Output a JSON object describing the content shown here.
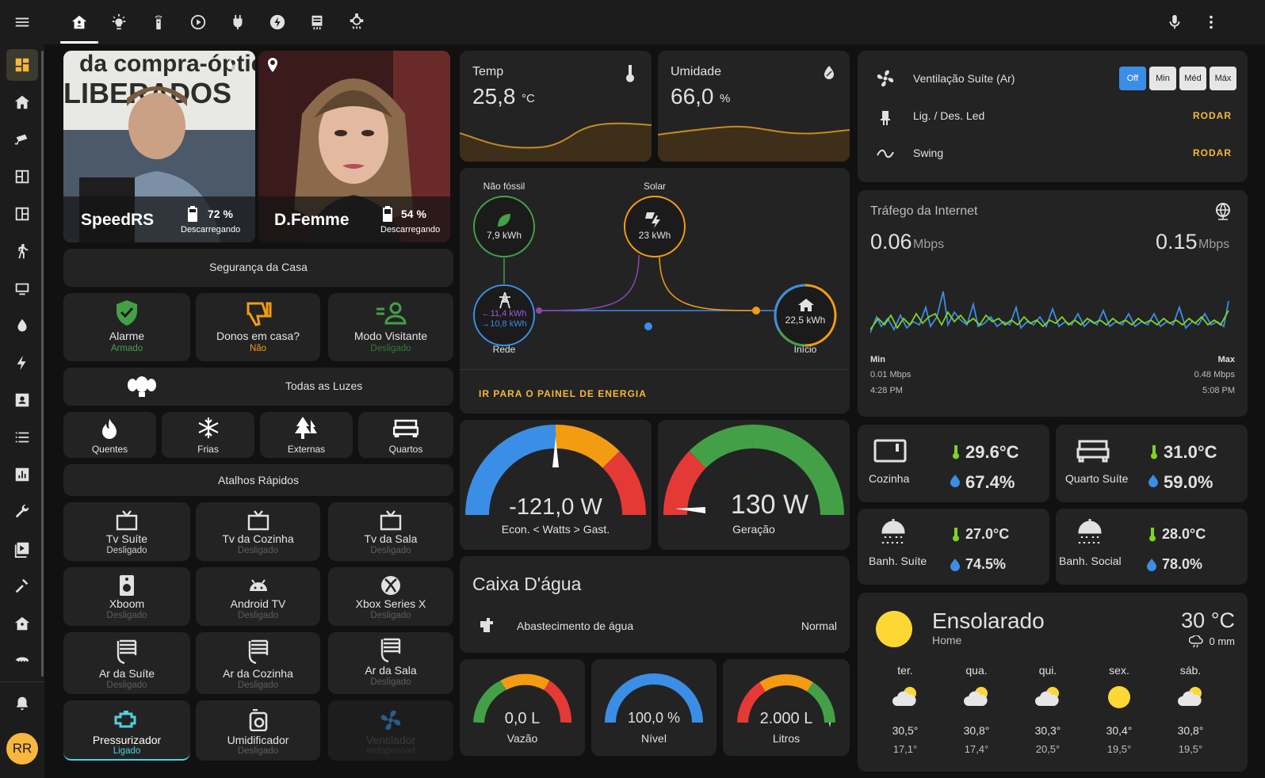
{
  "user": {
    "initials": "RR"
  },
  "persons": [
    {
      "name": "SpeedRS",
      "battery": "72 %",
      "battery_state": "Descarregando"
    },
    {
      "name": "D.Femme",
      "battery": "54 %",
      "battery_state": "Descarregando"
    }
  ],
  "security": {
    "title": "Segurança da Casa",
    "items": [
      {
        "name": "Alarme",
        "state": "Armado"
      },
      {
        "name": "Donos em casa?",
        "state": "Não"
      },
      {
        "name": "Modo Visitante",
        "state": "Desligado"
      }
    ]
  },
  "lights": {
    "title": "Todas as Luzes",
    "items": [
      "Quentes",
      "Frias",
      "Externas",
      "Quartos"
    ]
  },
  "shortcuts": {
    "title": "Atalhos Rápidos",
    "items": [
      {
        "name": "Tv Suíte",
        "state": "Desligado"
      },
      {
        "name": "Tv da Cozinha",
        "state": "Desligado"
      },
      {
        "name": "Tv da Sala",
        "state": "Desligado"
      },
      {
        "name": "Xboom",
        "state": "Desligado"
      },
      {
        "name": "Android TV",
        "state": "Desligado"
      },
      {
        "name": "Xbox Series X",
        "state": "Desligado"
      },
      {
        "name": "Ar da Suíte",
        "state": "Desligado"
      },
      {
        "name": "Ar da Cozinha",
        "state": "Desligado"
      },
      {
        "name": "Ar da Sala",
        "state": "Desligado"
      },
      {
        "name": "Pressurizador",
        "state": "Ligado"
      },
      {
        "name": "Umidificador",
        "state": "Desligado"
      },
      {
        "name": "Ventilador",
        "state": "Indisponível"
      }
    ]
  },
  "sensors": {
    "temp": {
      "title": "Temp",
      "value": "25,8",
      "unit": "°C"
    },
    "humidity": {
      "title": "Umidade",
      "value": "66,0",
      "unit": "%"
    }
  },
  "energy": {
    "fossil": {
      "label": "Não fóssil",
      "value": "7,9 kWh"
    },
    "solar": {
      "label": "Solar",
      "value": "23 kWh"
    },
    "grid": {
      "label": "Rede",
      "in": "←11,4 kWh",
      "out": "→10,8 kWh"
    },
    "home": {
      "label": "Início",
      "value": "22,5 kWh"
    },
    "link": "IR PARA O PAINEL DE ENERGIA"
  },
  "power_gauges": [
    {
      "value": "-121,0 W",
      "label": "Econ. < Watts > Gast.",
      "fraction": 0.48
    },
    {
      "value": "130 W",
      "label": "Geração",
      "fraction": 0.02
    }
  ],
  "water": {
    "title": "Caixa D'água",
    "row": {
      "name": "Abastecimento de água",
      "state": "Normal"
    },
    "gauges": [
      {
        "value": "0,0 L",
        "label": "Vazão",
        "fraction": 0.0
      },
      {
        "value": "100,0 %",
        "label": "Nível",
        "fraction": 1.0
      },
      {
        "value": "2.000 L",
        "label": "Litros",
        "fraction": 0.97
      }
    ]
  },
  "ac": {
    "rows": [
      {
        "name": "Ventilação Suíte (Ar)"
      },
      {
        "name": "Lig. / Des. Led",
        "action": "RODAR"
      },
      {
        "name": "Swing",
        "action": "RODAR"
      }
    ],
    "modes": [
      "Off",
      "Min",
      "Méd",
      "Máx"
    ],
    "active_mode": "Off"
  },
  "internet": {
    "title": "Tráfego da Internet",
    "download": "0.06",
    "upload": "0.15",
    "unit": "Mbps",
    "min_label": "Min",
    "min_value": "0.01 Mbps",
    "min_time": "4:28 PM",
    "max_label": "Max",
    "max_value": "0.48 Mbps",
    "max_time": "5:08 PM"
  },
  "rooms": [
    {
      "name": "Cozinha",
      "temp": "29.6°C",
      "hum": "67.4%"
    },
    {
      "name": "Quarto Suíte",
      "temp": "31.0°C",
      "hum": "59.0%"
    },
    {
      "name": "Banh. Suíte",
      "temp": "27.0°C",
      "hum": "74.5%"
    },
    {
      "name": "Banh. Social",
      "temp": "28.0°C",
      "hum": "78.0%"
    }
  ],
  "weather": {
    "condition": "Ensolarado",
    "location": "Home",
    "temp": "30 °C",
    "precip": "0 mm",
    "forecast": [
      {
        "day": "ter.",
        "high": "30,5°",
        "low": "17,1°",
        "icon": "partly-cloudy"
      },
      {
        "day": "qua.",
        "high": "30,8°",
        "low": "17,4°",
        "icon": "partly-cloudy"
      },
      {
        "day": "qui.",
        "high": "30,3°",
        "low": "20,5°",
        "icon": "partly-cloudy"
      },
      {
        "day": "sex.",
        "high": "30,4°",
        "low": "19,5°",
        "icon": "sunny"
      },
      {
        "day": "sáb.",
        "high": "30,8°",
        "low": "19,5°",
        "icon": "partly-cloudy"
      }
    ]
  },
  "colors": {
    "accent": "#f6b73c",
    "active_blue": "#3b8ee5",
    "green": "#43a047",
    "orange": "#f39c12",
    "red": "#e53935",
    "cyan": "#4dd0e1"
  }
}
